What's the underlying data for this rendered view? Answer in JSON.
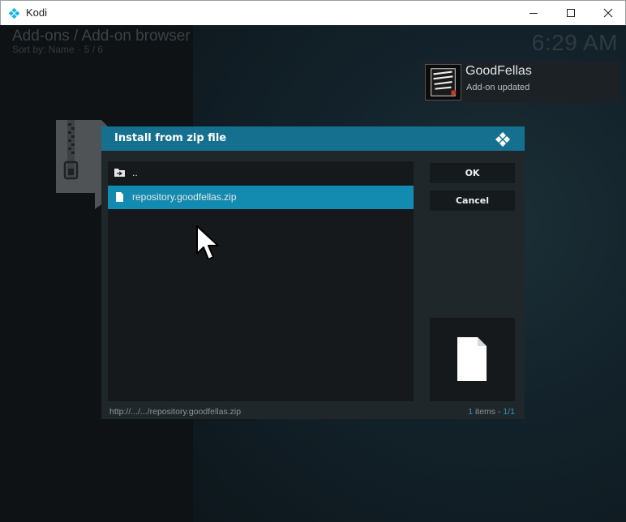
{
  "window": {
    "title": "Kodi",
    "icon": "kodi-logo-icon"
  },
  "header": {
    "title": "Add-ons / Add-on browser",
    "sort_label": "Sort by: Name",
    "separator": "·",
    "position": "5 / 6",
    "clock": "6:29 AM"
  },
  "notification": {
    "title": "GoodFellas",
    "message": "Add-on updated"
  },
  "dialog": {
    "title": "Install from zip file",
    "items": [
      {
        "label": "..",
        "icon": "folder-up-icon"
      },
      {
        "label": "repository.goodfellas.zip",
        "icon": "file-icon",
        "selected": true
      }
    ],
    "ok_label": "OK",
    "cancel_label": "Cancel",
    "path": "http://.../.../repository.goodfellas.zip",
    "count": "1",
    "count_label": " items - ",
    "page": "1/1"
  },
  "colors": {
    "accent": "#14708e",
    "selected": "#138bb0",
    "highlight_text": "#2a9bc4"
  }
}
